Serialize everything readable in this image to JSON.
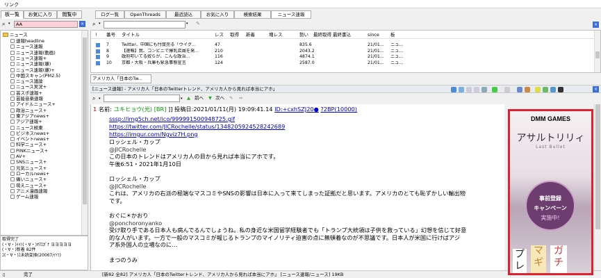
{
  "menubar": {
    "label": "リンク"
  },
  "left_tabs": [
    "板一覧",
    "お気に入り",
    "閲覧中"
  ],
  "right_tabs": [
    "ログ一覧",
    "OpenThreads",
    "最近読込",
    "お気に入り",
    "検索結果",
    "ニュース速報"
  ],
  "left_search": {
    "value": "AA"
  },
  "tree": {
    "root": "ニュース",
    "items": [
      "速報headline",
      "ニュース速報",
      "ニュース速報(動画)",
      "ニュース速報+",
      "ニュース速報(嫌)",
      "ニュース速報(嫌)+",
      "中国スキャン(PM2.5)",
      "ニュース議論",
      "ニュース実況+",
      "芸スポ速報+",
      "芸能音楽速報",
      "アイドルニュース+",
      "政治ニュース+",
      "東アジアnews+",
      "アジア速報+",
      "ニュース極東",
      "ビジネスnews+",
      "イベントnews+",
      "科学ニュース+",
      "PINKニュース+",
      "AV+",
      "SNSニュース+",
      "元気ニュース+",
      "ローカルnews+",
      "痛いニュース+",
      "萌えニュース+",
      "アニメ漫画速報",
      "ゲーム速報"
    ]
  },
  "log": {
    "lines": [
      "取得完了",
      "(・∀・)ｲｲ!(・∀・)ｵﾏｴｶﾞﾅ ヨヨヨヨヨ",
      "(・∀・)新着 82件",
      "ﾕ(・∀・)ﾕ未読変換(20067/ｲｲ!)"
    ]
  },
  "status": {
    "left": "完了",
    "main": "[新82 全82] アメリカ人「日本のTwitterトレンド、アメリカ人から見れば本当にアホ」 [ニュース速報/ニュース] 19KB"
  },
  "thread_list": {
    "headers": [
      "!",
      "番号",
      "タイトル",
      "レス",
      "取得",
      "新着",
      "増レス",
      "勢い",
      "最終取得",
      "最終書込",
      "since",
      "板"
    ],
    "rows": [
      {
        "num": "7",
        "title": "Twitter、中国にも忖度売る「ウイグ...",
        "res": "47",
        "ikioi": "835.6",
        "since": "21/01...",
        "board": "ニュ..."
      },
      {
        "num": "8",
        "title": "【速報】我、コンビニで爆乳店員を発...",
        "res": "210",
        "ikioi": "2043.2",
        "since": "21/01...",
        "board": "ニュ..."
      },
      {
        "num": "9",
        "title": "政府叩いてる奴らが、こんな政治...",
        "res": "116",
        "ikioi": "4874.1",
        "since": "21/01...",
        "board": "ニュ..."
      },
      {
        "num": "10",
        "title": "京都・大阪・兵庫も緊急事態宣言",
        "res": "124",
        "ikioi": "2587.0",
        "since": "21/01...",
        "board": "ニュ..."
      }
    ]
  },
  "thread_tab": "アメリカ人「日本のTw...",
  "thread_title": "[ニュース速報] - アメリカ人「日本のTwitterトレンド、アメリカ人から見れば本当にアホ」",
  "nav": {
    "prev": "前へ",
    "next": "次へ"
  },
  "post": {
    "num": "1",
    "name_label": "名前:",
    "name": "ユキヒョウ(光)",
    "br": "[BR]",
    "date": "]] 投稿日:2021/01/11(月) 19:09:41.14",
    "id_label": "ID:+cxhSZJ20●",
    "be": "?2BP(10000)",
    "links": [
      "sssp://img5ch.net/ico/999991500948725.gif",
      "https://twitter.com/JICRochelle/status/1348205924528242689",
      "https://imgur.com/Ngviz7H.png"
    ],
    "lines": [
      "ロッシェル・カップ",
      "@JICRochelle",
      "この日本のトレンドはアメリカ人の目から見れば本当にアホです。",
      "午後6:51・2021年1月10日",
      "",
      "ロッシェル・カップ",
      "@JICRochelle",
      "これは、アメリカの右派の極端なマスコミやSNSの影響は日本に入って来てしまった証拠だと思います。アメリカのとても恥ずかしい輸出物",
      "です。",
      "",
      "おぐに☀かおり",
      "@ponchoronyanko",
      "受け取り手である日本人も病んでるんでしょうね。私の身近な米国留学経験者でも「トランプ大統領は子供を救っている」幻想を信じて好意",
      "的な人がいます。一方で一般のマスコミが報じるトランプのマイノリティ迫害の点に無頓着なのが不思議です。日本人が米国に行けばアジ",
      "ア系外国人の立場なのに…",
      "",
      "まつのうみ"
    ]
  },
  "ad": {
    "brand": "DMM GAMES",
    "title": "アサルトリリィ",
    "subtitle": "Last Bullet",
    "badge_line1": "事前登録",
    "badge_line2": "キャンペーン",
    "badge_line3": "実施中!",
    "bottom": [
      "プ",
      "マ",
      "ガ",
      "レ",
      "ギ",
      "チ"
    ]
  },
  "colors": {
    "accent_red": "#e0202c",
    "link": "#0000cc",
    "name_green": "#009a00",
    "post_num": "#cc0000"
  }
}
